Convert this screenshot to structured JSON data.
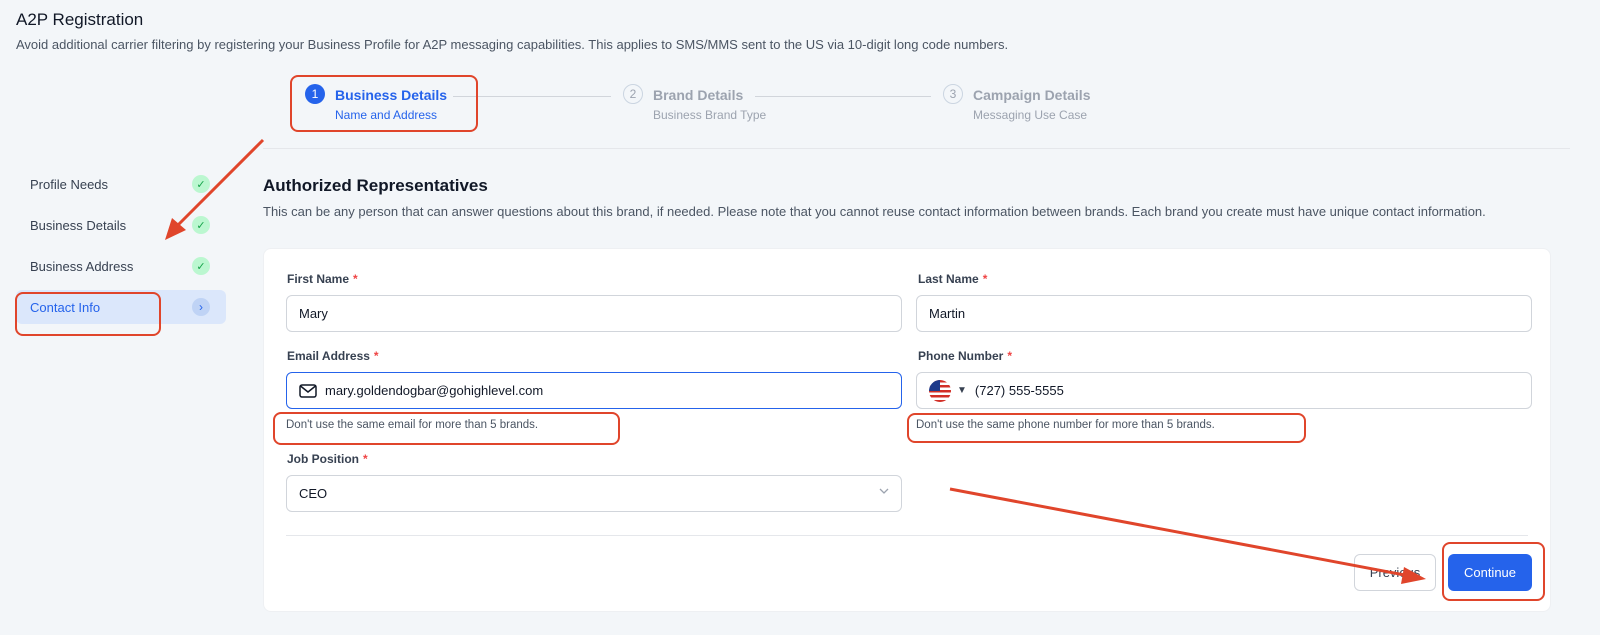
{
  "header": {
    "title": "A2P Registration",
    "subtitle": "Avoid additional carrier filtering by registering your Business Profile for A2P messaging capabilities. This applies to SMS/MMS sent to the US via 10-digit long code numbers."
  },
  "stepper": [
    {
      "number": "1",
      "title": "Business Details",
      "desc": "Name and Address"
    },
    {
      "number": "2",
      "title": "Brand Details",
      "desc": "Business Brand Type"
    },
    {
      "number": "3",
      "title": "Campaign Details",
      "desc": "Messaging Use Case"
    }
  ],
  "sidebar": {
    "items": [
      {
        "label": "Profile Needs"
      },
      {
        "label": "Business Details"
      },
      {
        "label": "Business Address"
      },
      {
        "label": "Contact Info"
      }
    ]
  },
  "section": {
    "title": "Authorized Representatives",
    "desc": "This can be any person that can answer questions about this brand, if needed. Please note that you cannot reuse contact information between brands. Each brand you create must have unique contact information."
  },
  "form": {
    "first_name": {
      "label": "First Name",
      "value": "Mary"
    },
    "last_name": {
      "label": "Last Name",
      "value": "Martin"
    },
    "email": {
      "label": "Email Address",
      "value": "mary.goldendogbar@gohighlevel.com",
      "hint": "Don't use the same email for more than 5 brands."
    },
    "phone": {
      "label": "Phone Number",
      "value": "(727) 555-5555",
      "hint": "Don't use the same phone number for more than 5 brands."
    },
    "job": {
      "label": "Job Position",
      "value": "CEO"
    },
    "required_mark": "*"
  },
  "buttons": {
    "previous": "Previous",
    "continue": "Continue"
  },
  "colors": {
    "accent": "#2563eb",
    "annotation": "#e0452b",
    "success": "#16a34a"
  }
}
